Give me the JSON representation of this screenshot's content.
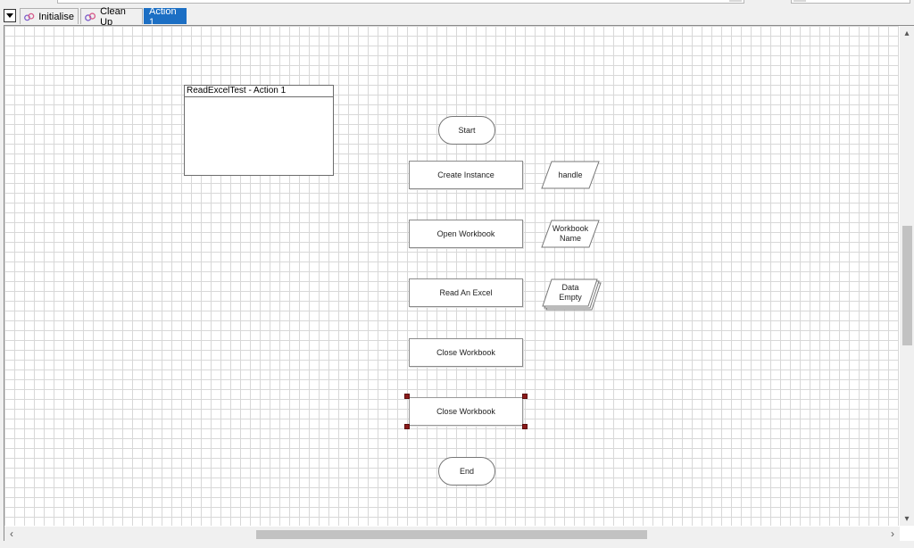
{
  "tabs": [
    {
      "label": "Initialise",
      "active": false
    },
    {
      "label": "Clean Up",
      "active": false
    },
    {
      "label": "Action 1",
      "active": true
    }
  ],
  "note": {
    "title": "ReadExcelTest - Action 1"
  },
  "stages": {
    "start": "Start",
    "create_instance": "Create Instance",
    "open_workbook": "Open Workbook",
    "read_excel": "Read An Excel",
    "close_workbook_1": "Close Workbook",
    "close_workbook_2": "Close Workbook",
    "end": "End"
  },
  "data_items": {
    "handle": "handle",
    "workbook_name": "Workbook Name",
    "data_empty": "Data Empty"
  },
  "colors": {
    "active_tab": "#1c6fc4",
    "grid_line": "#d8d8d8",
    "selection_handle": "#8b1a1a"
  }
}
